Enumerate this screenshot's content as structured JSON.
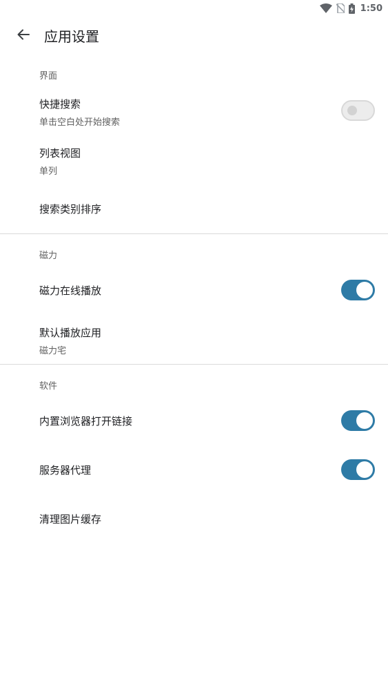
{
  "status_bar": {
    "time": "1:50",
    "icons": [
      "wifi-icon",
      "no-sim-icon",
      "battery-charging-icon"
    ]
  },
  "app_bar": {
    "back_icon": "arrow-back-icon",
    "title": "应用设置"
  },
  "sections": {
    "interface": {
      "header": "界面",
      "quick_search": {
        "title": "快捷搜索",
        "subtitle": "单击空白处开始搜索",
        "enabled": false
      },
      "list_view": {
        "title": "列表视图",
        "value": "单列"
      },
      "category_sort": {
        "title": "搜索类别排序"
      }
    },
    "magnet": {
      "header": "磁力",
      "online_play": {
        "title": "磁力在线播放",
        "enabled": true
      },
      "default_player": {
        "title": "默认播放应用",
        "value": "磁力宅"
      }
    },
    "software": {
      "header": "软件",
      "builtin_browser": {
        "title": "内置浏览器打开链接",
        "enabled": true
      },
      "server_proxy": {
        "title": "服务器代理",
        "enabled": true
      },
      "clear_cache": {
        "title": "清理图片缓存"
      }
    }
  },
  "colors": {
    "switch_on": "#2e7ba6",
    "switch_off": "#ececec",
    "divider": "#dadada"
  }
}
